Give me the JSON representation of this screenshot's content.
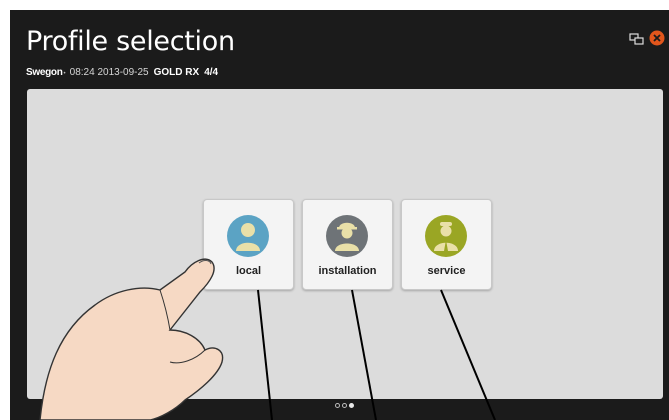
{
  "header": {
    "title": "Profile selection",
    "brand": "Swegon",
    "time_date": "08:24 2013-09-25",
    "model": "GOLD RX",
    "unit_count": "4/4"
  },
  "top_icons": [
    "screens-icon",
    "alarm-icon"
  ],
  "profiles": [
    {
      "label": "local",
      "icon": "person-icon",
      "color": "#5ba3c4"
    },
    {
      "label": "installation",
      "icon": "installer-icon",
      "color": "#6e7377"
    },
    {
      "label": "service",
      "icon": "service-technician-icon",
      "color": "#9aa624"
    }
  ],
  "pager": {
    "pages": 3,
    "active": 2
  },
  "colors": {
    "alarm": "#e2561c",
    "panel": "#dcdcdc",
    "background": "#1b1b1b"
  }
}
